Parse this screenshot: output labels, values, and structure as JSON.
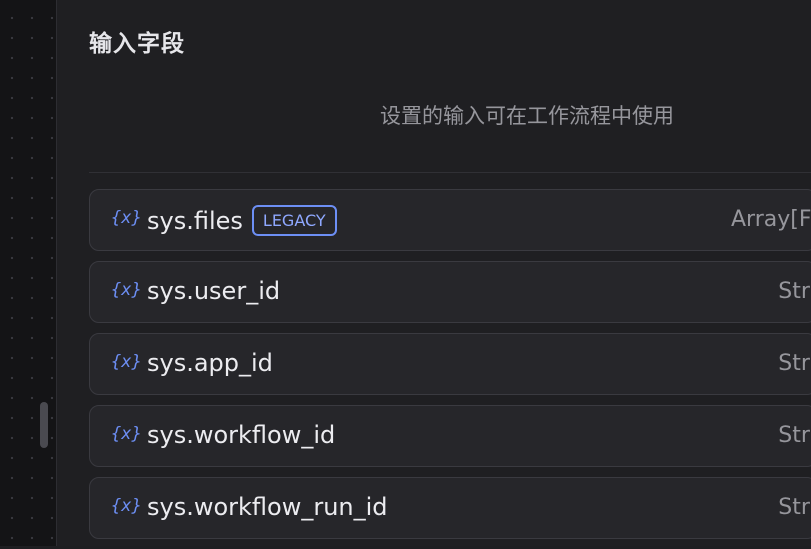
{
  "section": {
    "title": "输入字段",
    "hint": "设置的输入可在工作流程中使用"
  },
  "colors": {
    "accent": "#6d8ff5",
    "background": "#1f1f22",
    "row": "#26262a"
  },
  "icons": {
    "variable": "variable-brace-icon"
  },
  "variables": [
    {
      "icon": "{x}",
      "name": "sys.files",
      "badge": "LEGACY",
      "type": "Array[Fi"
    },
    {
      "icon": "{x}",
      "name": "sys.user_id",
      "type": "Stri"
    },
    {
      "icon": "{x}",
      "name": "sys.app_id",
      "type": "Stri"
    },
    {
      "icon": "{x}",
      "name": "sys.workflow_id",
      "type": "Stri"
    },
    {
      "icon": "{x}",
      "name": "sys.workflow_run_id",
      "type": "Stri"
    }
  ]
}
